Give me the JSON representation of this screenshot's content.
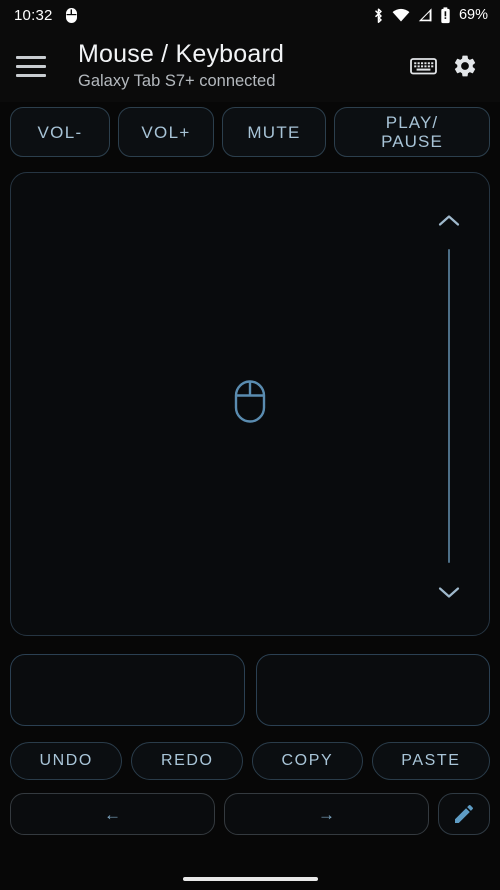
{
  "status_bar": {
    "time": "10:32",
    "icons": [
      "mouse-icon",
      "bluetooth-icon",
      "wifi-icon",
      "cellular-signal-icon",
      "battery-icon"
    ],
    "battery_percent": "69%"
  },
  "header": {
    "menu_icon": "hamburger-menu-icon",
    "title": "Mouse / Keyboard",
    "subtitle": "Galaxy Tab S7+ connected",
    "keyboard_icon": "keyboard-icon",
    "settings_icon": "gear-icon"
  },
  "media_controls": [
    {
      "label": "VOL-"
    },
    {
      "label": "VOL+"
    },
    {
      "label": "MUTE"
    },
    {
      "label": "PLAY/\nPAUSE"
    }
  ],
  "touchpad": {
    "center_icon": "mouse-icon",
    "scroll_up_icon": "chevron-up-icon",
    "scroll_down_icon": "chevron-down-icon"
  },
  "mouse_buttons": [
    {
      "name": "left-click"
    },
    {
      "name": "right-click"
    }
  ],
  "edit_controls": [
    {
      "label": "UNDO"
    },
    {
      "label": "REDO"
    },
    {
      "label": "COPY"
    },
    {
      "label": "PASTE"
    }
  ],
  "nav_controls": {
    "back_icon": "arrow-left-icon",
    "forward_icon": "arrow-right-icon",
    "edit_icon": "pencil-icon",
    "back_glyph": "←",
    "forward_glyph": "→"
  },
  "colors": {
    "background": "#070707",
    "accent": "#7ea8c4",
    "border": "#2b3e4d",
    "text": "#a9c5d8",
    "title": "#f2f4f6",
    "subtitle": "#b4b9be"
  }
}
